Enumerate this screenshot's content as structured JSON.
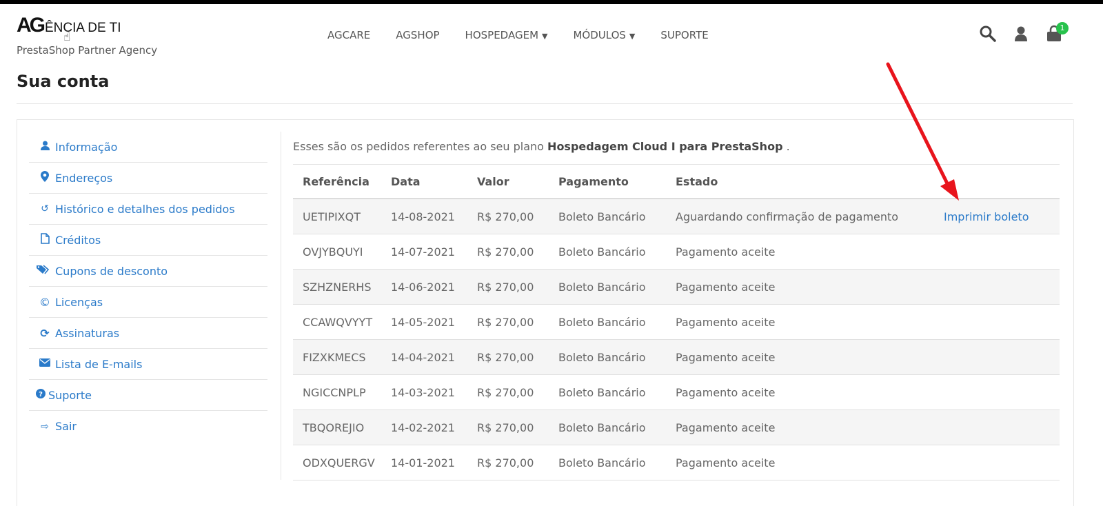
{
  "header": {
    "logo_mark": "AG",
    "logo_text": "ÊNCIA DE TI",
    "logo_subtitle": "PrestaShop Partner Agency",
    "nav": [
      {
        "label": "AGCARE",
        "dropdown": false
      },
      {
        "label": "AGSHOP",
        "dropdown": false
      },
      {
        "label": "HOSPEDAGEM",
        "dropdown": true
      },
      {
        "label": "MÓDULOS",
        "dropdown": true
      },
      {
        "label": "SUPORTE",
        "dropdown": false
      }
    ],
    "icons": [
      "search-icon",
      "user-icon",
      "cart-icon"
    ],
    "cart_count": "1"
  },
  "page_title": "Sua conta",
  "sidebar": {
    "items": [
      {
        "label": "Informação",
        "icon": "user-icon"
      },
      {
        "label": "Endereços",
        "icon": "map-marker-icon"
      },
      {
        "label": "Histórico e detalhes dos pedidos",
        "icon": "history-icon"
      },
      {
        "label": "Créditos",
        "icon": "file-icon"
      },
      {
        "label": "Cupons de desconto",
        "icon": "tags-icon"
      },
      {
        "label": "Licenças",
        "icon": "copyright-icon"
      },
      {
        "label": "Assinaturas",
        "icon": "refresh-icon"
      },
      {
        "label": "Lista de E-mails",
        "icon": "envelope-icon"
      },
      {
        "label": "Suporte",
        "icon": "question-circle-icon"
      },
      {
        "label": "Sair",
        "icon": "sign-out-icon"
      }
    ]
  },
  "intro": {
    "prefix": "Esses são os pedidos referentes ao seu plano ",
    "plan": "Hospedagem Cloud I para PrestaShop",
    "suffix": " ."
  },
  "orders": {
    "headers": [
      "Referência",
      "Data",
      "Valor",
      "Pagamento",
      "Estado",
      ""
    ],
    "rows": [
      {
        "ref": "UETIPIXQT",
        "date": "14-08-2021",
        "value": "R$ 270,00",
        "payment": "Boleto Bancário",
        "status": "Aguardando confirmação de pagamento",
        "action": "Imprimir boleto"
      },
      {
        "ref": "OVJYBQUYI",
        "date": "14-07-2021",
        "value": "R$ 270,00",
        "payment": "Boleto Bancário",
        "status": "Pagamento aceite",
        "action": ""
      },
      {
        "ref": "SZHZNERHS",
        "date": "14-06-2021",
        "value": "R$ 270,00",
        "payment": "Boleto Bancário",
        "status": "Pagamento aceite",
        "action": ""
      },
      {
        "ref": "CCAWQVYYT",
        "date": "14-05-2021",
        "value": "R$ 270,00",
        "payment": "Boleto Bancário",
        "status": "Pagamento aceite",
        "action": ""
      },
      {
        "ref": "FIZXKMECS",
        "date": "14-04-2021",
        "value": "R$ 270,00",
        "payment": "Boleto Bancário",
        "status": "Pagamento aceite",
        "action": ""
      },
      {
        "ref": "NGICCNPLP",
        "date": "14-03-2021",
        "value": "R$ 270,00",
        "payment": "Boleto Bancário",
        "status": "Pagamento aceite",
        "action": ""
      },
      {
        "ref": "TBQOREJIO",
        "date": "14-02-2021",
        "value": "R$ 270,00",
        "payment": "Boleto Bancário",
        "status": "Pagamento aceite",
        "action": ""
      },
      {
        "ref": "ODXQUERGV",
        "date": "14-01-2021",
        "value": "R$ 270,00",
        "payment": "Boleto Bancário",
        "status": "Pagamento aceite",
        "action": ""
      }
    ]
  },
  "colors": {
    "link": "#2a7ac9",
    "badge": "#27c24c",
    "annotation_arrow": "#e8141c"
  }
}
